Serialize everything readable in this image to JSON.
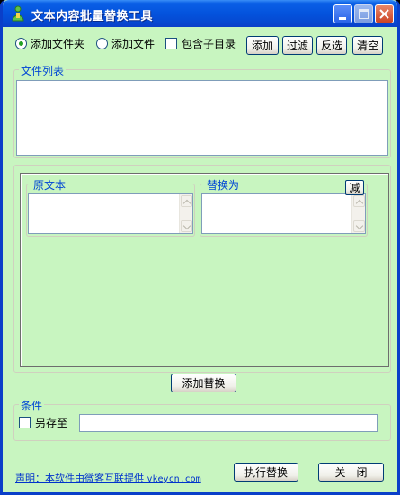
{
  "window": {
    "title": "文本内容批量替换工具",
    "icon": "green-figure-icon"
  },
  "options": {
    "add_folder": "添加文件夹",
    "add_file": "添加文件",
    "include_subdirs": "包含子目录",
    "selected": "add_folder",
    "include_subdirs_checked": false
  },
  "toolbar": {
    "add": "添加",
    "filter": "过滤",
    "invert": "反选",
    "clear": "清空"
  },
  "file_list": {
    "label": "文件列表",
    "items": []
  },
  "replace": {
    "source_label": "原文本",
    "target_label": "替换为",
    "source_value": "",
    "target_value": "",
    "remove_button": "减",
    "add_button": "添加替换"
  },
  "conditions": {
    "label": "条件",
    "save_as": "另存至",
    "save_as_checked": false,
    "save_path": ""
  },
  "footer": {
    "notice": "声明：本软件由微客互联提供 ",
    "url": "vkeycn.com",
    "execute": "执行替换",
    "close": "关　闭"
  },
  "colors": {
    "background": "#c8f5c0",
    "titlebar": "#0453dd",
    "label_blue": "#0046d5",
    "link_blue": "#0033cc"
  }
}
